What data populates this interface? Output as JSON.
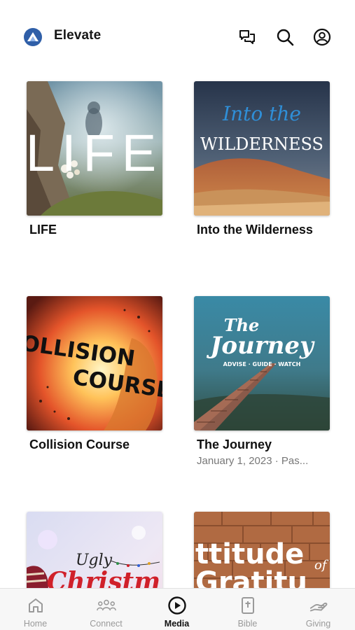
{
  "status_bar": {
    "text": ""
  },
  "header": {
    "title": "Elevate",
    "icons": {
      "logo": "app-logo",
      "chat": "chat-bubbles-icon",
      "search": "search-icon",
      "account": "account-circle-icon"
    }
  },
  "media_items": [
    {
      "title": "LIFE",
      "subtitle": "",
      "art_text": "LIFE"
    },
    {
      "title": "Into the Wilderness",
      "subtitle": "",
      "art_script": "Into the",
      "art_text": "WILDERNESS"
    },
    {
      "title": "Collision Course",
      "subtitle": "",
      "art_line1": "COLLISION",
      "art_line2": "COURSE"
    },
    {
      "title": "The Journey",
      "subtitle": "January 1, 2023 · Pas...",
      "art_script1": "The",
      "art_script2": "Journey",
      "art_tagline": "ADVISE · GUIDE · WATCH"
    },
    {
      "title": "",
      "subtitle": "",
      "art_line1": "Ugly",
      "art_line2": "Christm"
    },
    {
      "title": "",
      "subtitle": "",
      "art_line1": "ttitude",
      "art_line2": "of",
      "art_line3": "Gratitu"
    }
  ],
  "tab_bar": {
    "active": "Media",
    "tabs": [
      {
        "label": "Home",
        "icon": "home-icon"
      },
      {
        "label": "Connect",
        "icon": "people-icon"
      },
      {
        "label": "Media",
        "icon": "play-circle-icon"
      },
      {
        "label": "Bible",
        "icon": "bible-icon"
      },
      {
        "label": "Giving",
        "icon": "giving-hand-icon"
      }
    ]
  },
  "colors": {
    "accent": "#111111",
    "inactive": "#9a9a9a",
    "logo_blue": "#2f5fa8"
  }
}
